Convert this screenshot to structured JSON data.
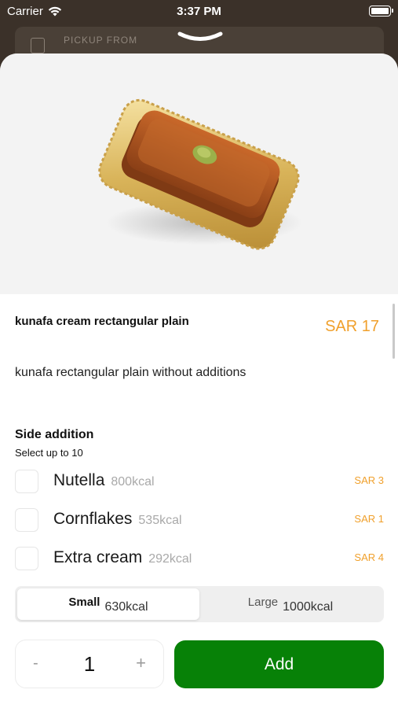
{
  "status_bar": {
    "carrier": "Carrier",
    "time": "3:37 PM",
    "wifi_icon": "wifi-icon",
    "battery_icon": "battery-icon"
  },
  "background": {
    "pickup_label": "PICKUP FROM",
    "pickup_value": "··· ··"
  },
  "product": {
    "name": "kunafa cream rectangular plain",
    "price": "SAR 17",
    "description": "kunafa rectangular plain without additions"
  },
  "side_addition": {
    "title": "Side addition",
    "subtitle": "Select up to 10",
    "items": [
      {
        "name": "Nutella",
        "kcal": "800kcal",
        "price": "SAR 3"
      },
      {
        "name": "Cornflakes",
        "kcal": "535kcal",
        "price": "SAR 1"
      },
      {
        "name": "Extra cream",
        "kcal": "292kcal",
        "price": "SAR 4"
      }
    ]
  },
  "size": {
    "options": [
      {
        "label": "Small",
        "kcal": "630kcal",
        "selected": true
      },
      {
        "label": "Large",
        "kcal": "1000kcal",
        "selected": false
      }
    ]
  },
  "quantity": {
    "minus": "-",
    "value": "1",
    "plus": "+"
  },
  "add_button": {
    "label": "Add"
  },
  "colors": {
    "accent": "#f0a02c",
    "primary": "#078107",
    "backdrop": "#3b3129"
  }
}
